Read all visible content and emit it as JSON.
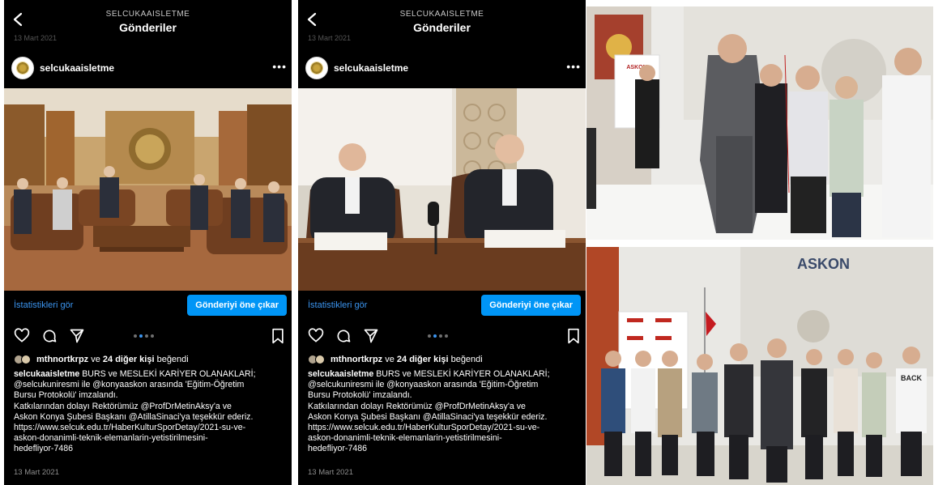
{
  "posts": [
    {
      "account_small": "SELCUKAAISLETME",
      "title": "Gönderiler",
      "prev_date": "13 Mart 2021",
      "username": "selcukaaisletme",
      "insights_label": "İstatistikleri gör",
      "promote_label": "Gönderiyi öne çıkar",
      "liked_user": "mthnortkrpz",
      "likes_connector": "ve",
      "likes_others": "24 diğer kişi",
      "likes_suffix": "beğendi",
      "caption_user": "selcukaaisletme",
      "caption_line1": "BURS ve MESLEKİ KARİYER OLANAKLARİ;",
      "caption_line2": "@selcukuniresmi ile @konyaaskon arasında 'Eğitim-Öğretim",
      "caption_line3": "Bursu Protokolü' imzalandı.",
      "caption_line4": "Katkılarından dolayı Rektörümüz @ProfDrMetinAksy'a ve",
      "caption_line5": "Askon Konya Şubesi Başkanı @AtillaSinaci'ya teşekkür ederiz.",
      "caption_line6": "https://www.selcuk.edu.tr/HaberKulturSporDetay/2021-su-ve-",
      "caption_line7": "askon-donanimli-teknik-elemanlarin-yetistirilmesini-",
      "caption_line8": "hedefliyor-7486",
      "date": "13 Mart 2021"
    },
    {
      "account_small": "SELCUKAAISLETME",
      "title": "Gönderiler",
      "prev_date": "13 Mart 2021",
      "username": "selcukaaisletme",
      "insights_label": "İstatistikleri gör",
      "promote_label": "Gönderiyi öne çıkar",
      "liked_user": "mthnortkrpz",
      "likes_connector": "ve",
      "likes_others": "24 diğer kişi",
      "likes_suffix": "beğendi",
      "caption_user": "selcukaaisletme",
      "caption_line1": "BURS ve MESLEKİ KARİYER OLANAKLARİ;",
      "caption_line2": "@selcukuniresmi ile @konyaaskon arasında 'Eğitim-Öğretim",
      "caption_line3": "Bursu Protokolü' imzalandı.",
      "caption_line4": "Katkılarından dolayı Rektörümüz @ProfDrMetinAksy'a ve",
      "caption_line5": "Askon Konya Şubesi Başkanı @AtillaSinaci'ya teşekkür ederiz.",
      "caption_line6": "https://www.selcuk.edu.tr/HaberKulturSporDetay/2021-su-ve-",
      "caption_line7": "askon-donanimli-teknik-elemanlarin-yetistirilmesini-",
      "caption_line8": "hedefliyor-7486",
      "date": "13 Mart 2021"
    }
  ],
  "icons": [
    "back-arrow-icon",
    "more-options-icon",
    "heart-icon",
    "comment-icon",
    "share-icon",
    "bookmark-icon"
  ],
  "colors": {
    "background": "#000000",
    "link_blue": "#3b95f0",
    "button_blue": "#0095f6",
    "muted": "#8e8e8e"
  },
  "photos": {
    "top_right_banner": "ASKON",
    "bottom_right_banner": "ASKON",
    "bottom_right_shirt": "BACK"
  },
  "carousel": {
    "count": 4,
    "active": 2
  }
}
